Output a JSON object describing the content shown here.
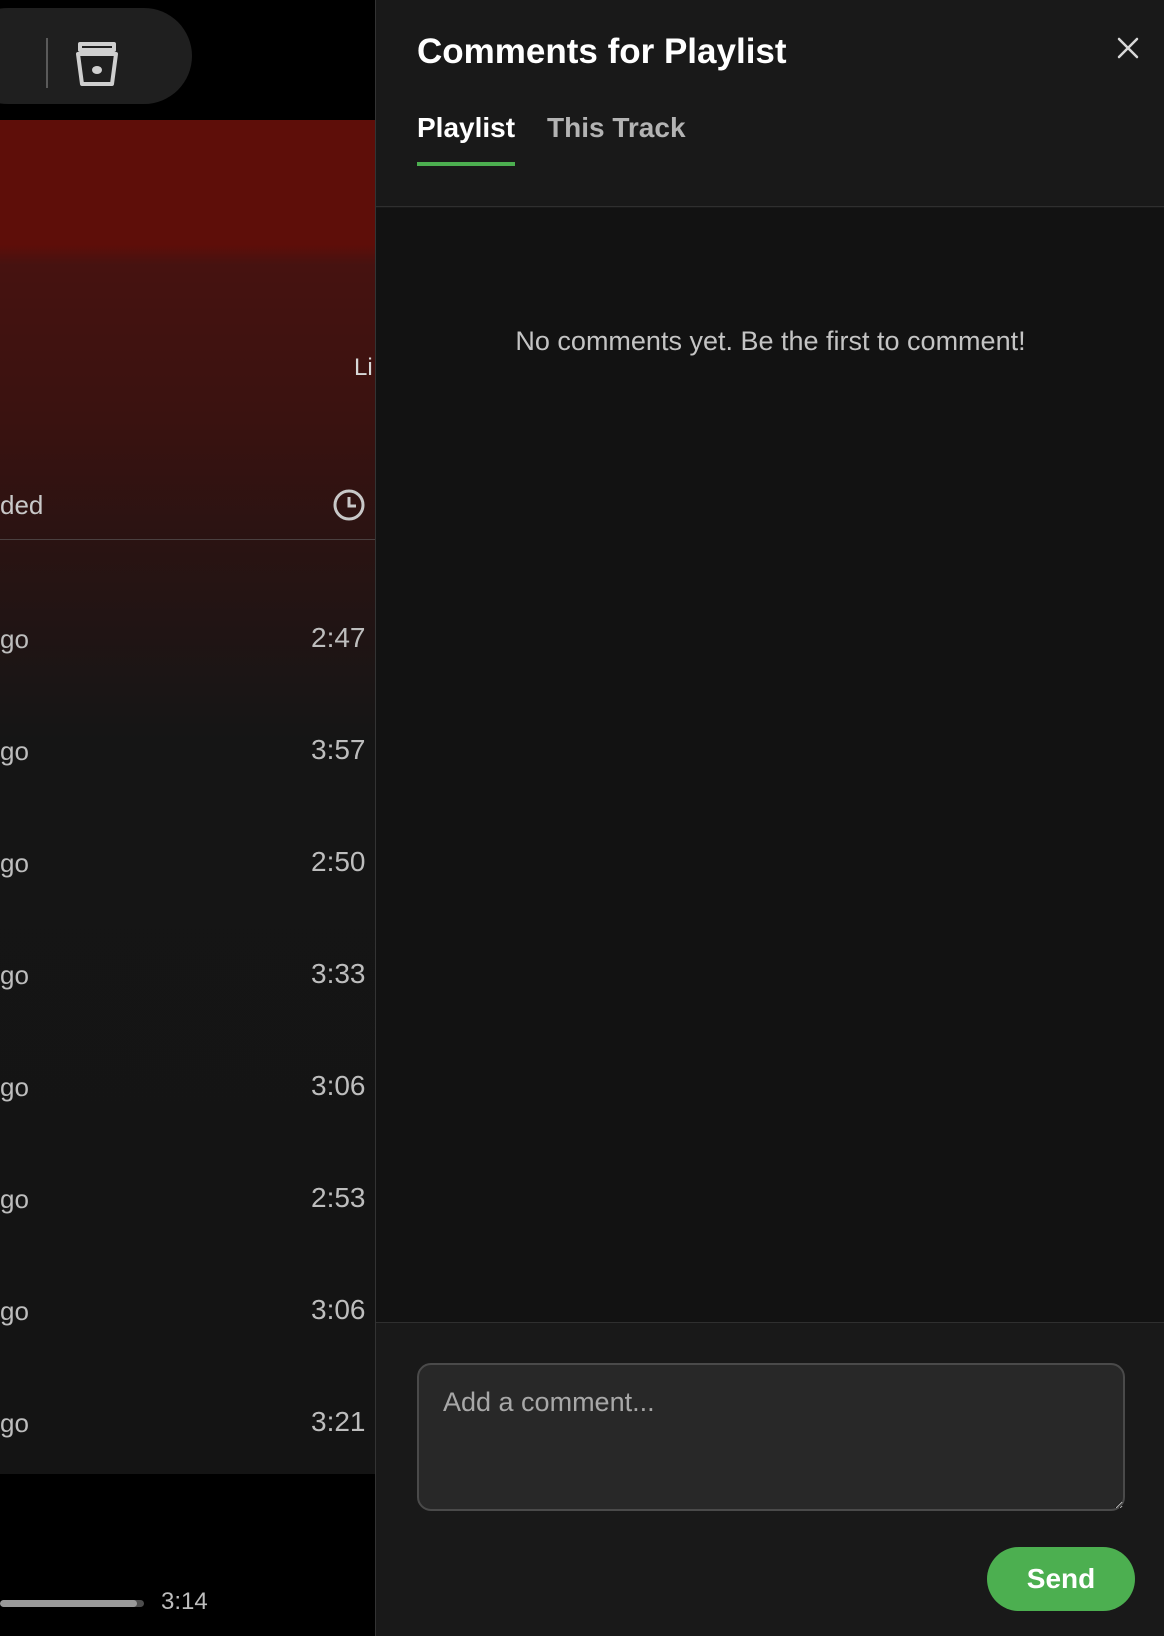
{
  "background_app": {
    "hero_partial_text": "Li",
    "column_header_partial": "ded",
    "tracks": [
      {
        "added_partial": "go",
        "duration": "2:47"
      },
      {
        "added_partial": "go",
        "duration": "3:57"
      },
      {
        "added_partial": "go",
        "duration": "2:50"
      },
      {
        "added_partial": "go",
        "duration": "3:33"
      },
      {
        "added_partial": "go",
        "duration": "3:06"
      },
      {
        "added_partial": "go",
        "duration": "2:53"
      },
      {
        "added_partial": "go",
        "duration": "3:06"
      },
      {
        "added_partial": "go",
        "duration": "3:21"
      }
    ],
    "player": {
      "total_time": "3:14",
      "progress_fraction": 0.95
    },
    "icons": {
      "device": "speaker-device-icon",
      "duration_header": "clock-icon"
    }
  },
  "comments_panel": {
    "title": "Comments for Playlist",
    "tabs": [
      {
        "label": "Playlist",
        "active": true
      },
      {
        "label": "This Track",
        "active": false
      }
    ],
    "empty_message": "No comments yet. Be the first to comment!",
    "input_placeholder": "Add a comment...",
    "input_value": "",
    "send_label": "Send",
    "close_icon": "close-icon"
  },
  "colors": {
    "accent": "#4caf50",
    "panel_bg": "#191919",
    "body_bg": "#121212",
    "hero_red": "#5e0e09"
  }
}
